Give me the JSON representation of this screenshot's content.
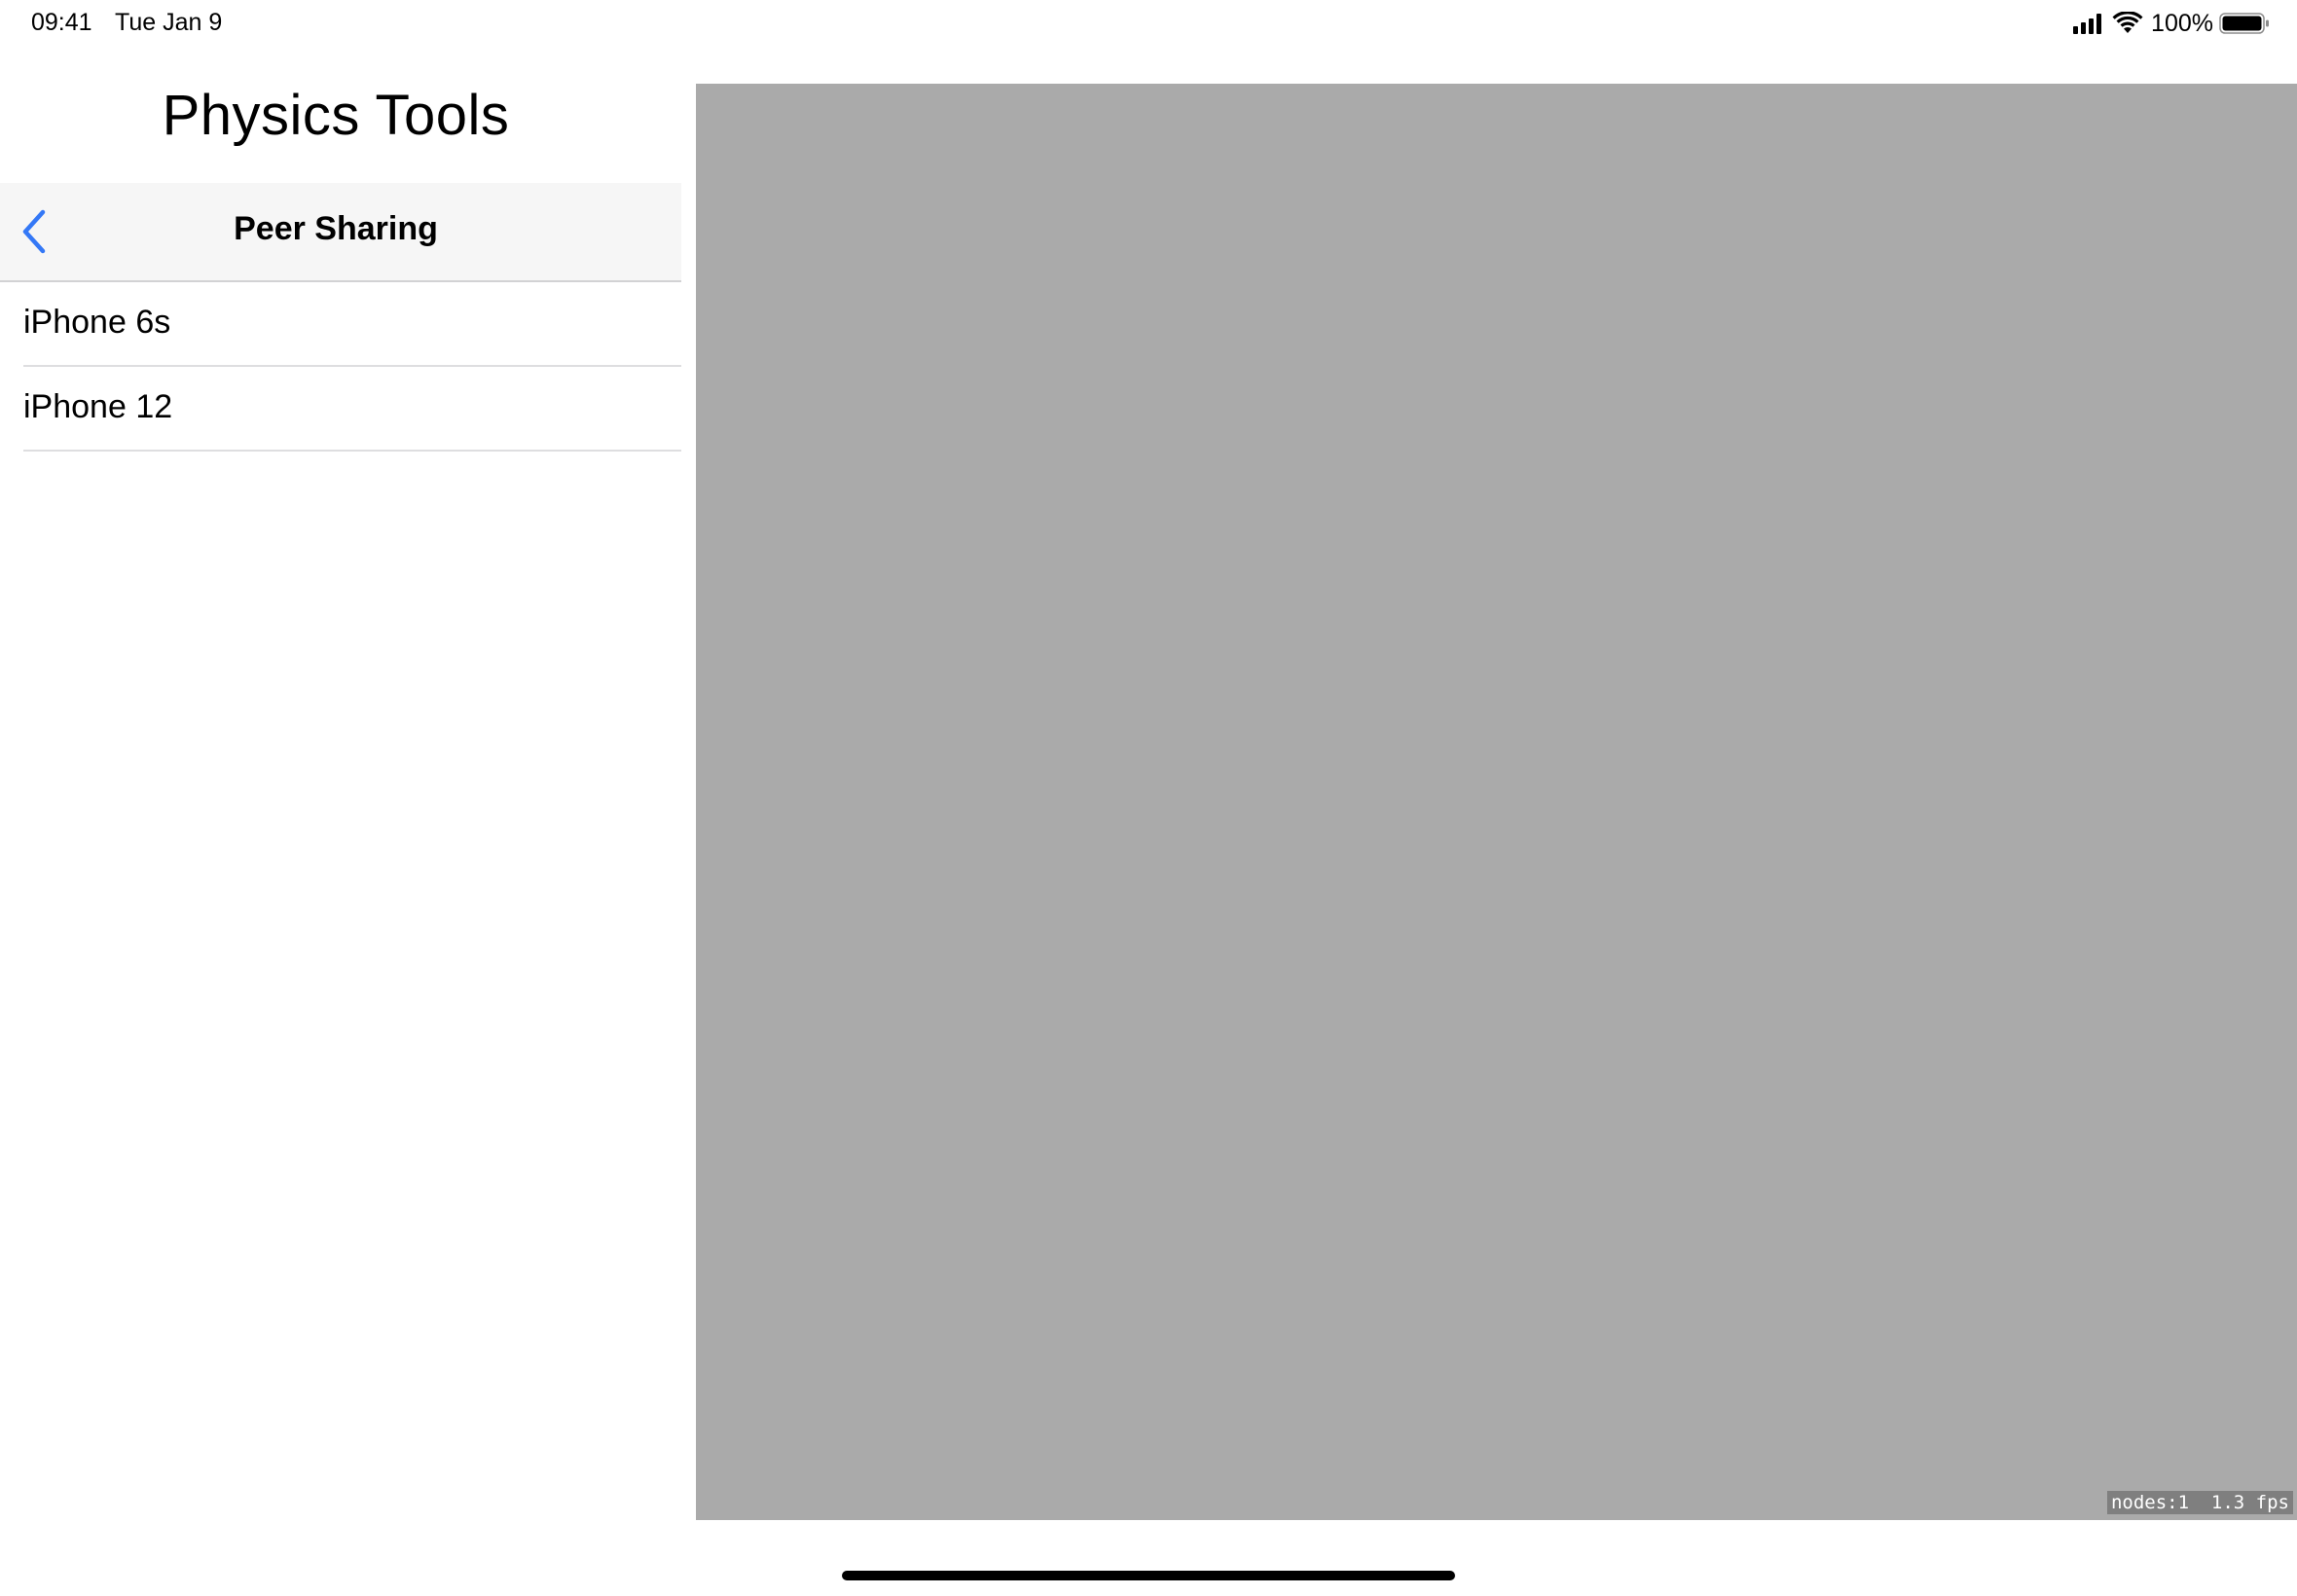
{
  "status_bar": {
    "time": "09:41",
    "date": "Tue Jan 9",
    "battery_percent": "100%",
    "icons": [
      "signal-icon",
      "wifi-icon",
      "battery-icon"
    ]
  },
  "sidebar": {
    "title": "Physics Tools",
    "navbar": {
      "back_icon": "chevron-left-icon",
      "title": "Peer Sharing"
    },
    "devices": [
      {
        "label": "iPhone 6s"
      },
      {
        "label": "iPhone 12"
      }
    ]
  },
  "scene": {
    "stats": "nodes:1  1.3 fps"
  },
  "colors": {
    "accent": "#3478f6",
    "scene_background": "#aaaaaa",
    "navbar_background": "#f6f6f6"
  }
}
